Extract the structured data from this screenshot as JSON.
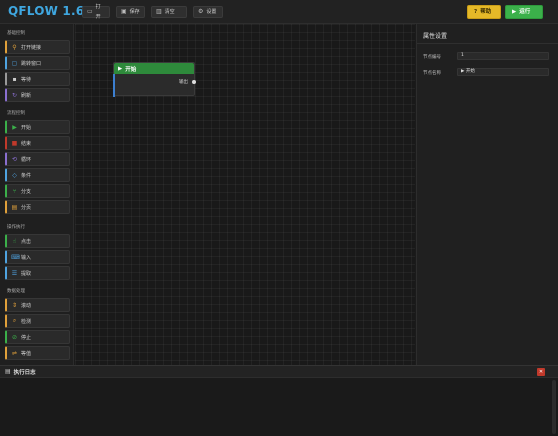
{
  "app": {
    "title": "QFLOW 1.6"
  },
  "toolbar": {
    "open_label": "打开",
    "save_label": "保存",
    "clear_label": "清空",
    "settings_label": "设置",
    "help_label": "帮助",
    "run_label": "运行"
  },
  "sidebar": {
    "sections": [
      {
        "title": "基础控制",
        "items": [
          {
            "label": "打开链接",
            "icon": "link-icon",
            "color": "#e0a03a"
          },
          {
            "label": "跳转窗口",
            "icon": "window-icon",
            "color": "#4fa3e0"
          },
          {
            "label": "等待",
            "icon": "wait-icon",
            "color": "#9a9a9a"
          },
          {
            "label": "刷新",
            "icon": "refresh-icon",
            "color": "#8a6fd0"
          }
        ]
      },
      {
        "title": "流程控制",
        "items": [
          {
            "label": "开始",
            "icon": "play-icon",
            "color": "#3bb04a"
          },
          {
            "label": "结束",
            "icon": "stop-icon",
            "color": "#c0392b"
          },
          {
            "label": "循环",
            "icon": "loop-icon",
            "color": "#8a6fd0"
          },
          {
            "label": "条件",
            "icon": "condition-icon",
            "color": "#4fa3e0"
          },
          {
            "label": "分支",
            "icon": "branch-icon",
            "color": "#3bb04a"
          },
          {
            "label": "分页",
            "icon": "page-icon",
            "color": "#e0a03a"
          }
        ]
      },
      {
        "title": "操作执行",
        "items": [
          {
            "label": "点击",
            "icon": "click-icon",
            "color": "#3bb04a"
          },
          {
            "label": "输入",
            "icon": "keyboard-icon",
            "color": "#4fa3e0"
          },
          {
            "label": "提取",
            "icon": "extract-icon",
            "color": "#4fa3e0"
          }
        ]
      },
      {
        "title": "数据处理",
        "items": [
          {
            "label": "滚动",
            "icon": "scroll-icon",
            "color": "#e0a03a"
          },
          {
            "label": "检测",
            "icon": "search-icon",
            "color": "#e0a03a"
          },
          {
            "label": "停止",
            "icon": "stop-icon",
            "color": "#3bb04a"
          },
          {
            "label": "等值",
            "icon": "equals-icon",
            "color": "#e0a03a"
          }
        ]
      }
    ]
  },
  "canvas": {
    "node": {
      "title": "开始",
      "output_label": "输出"
    }
  },
  "properties": {
    "title": "属性设置",
    "fields": [
      {
        "label": "节点编号",
        "value": "1"
      },
      {
        "label": "节点名称",
        "value": "▶ 开始"
      }
    ]
  },
  "log": {
    "title": "执行日志",
    "close": "✕"
  }
}
